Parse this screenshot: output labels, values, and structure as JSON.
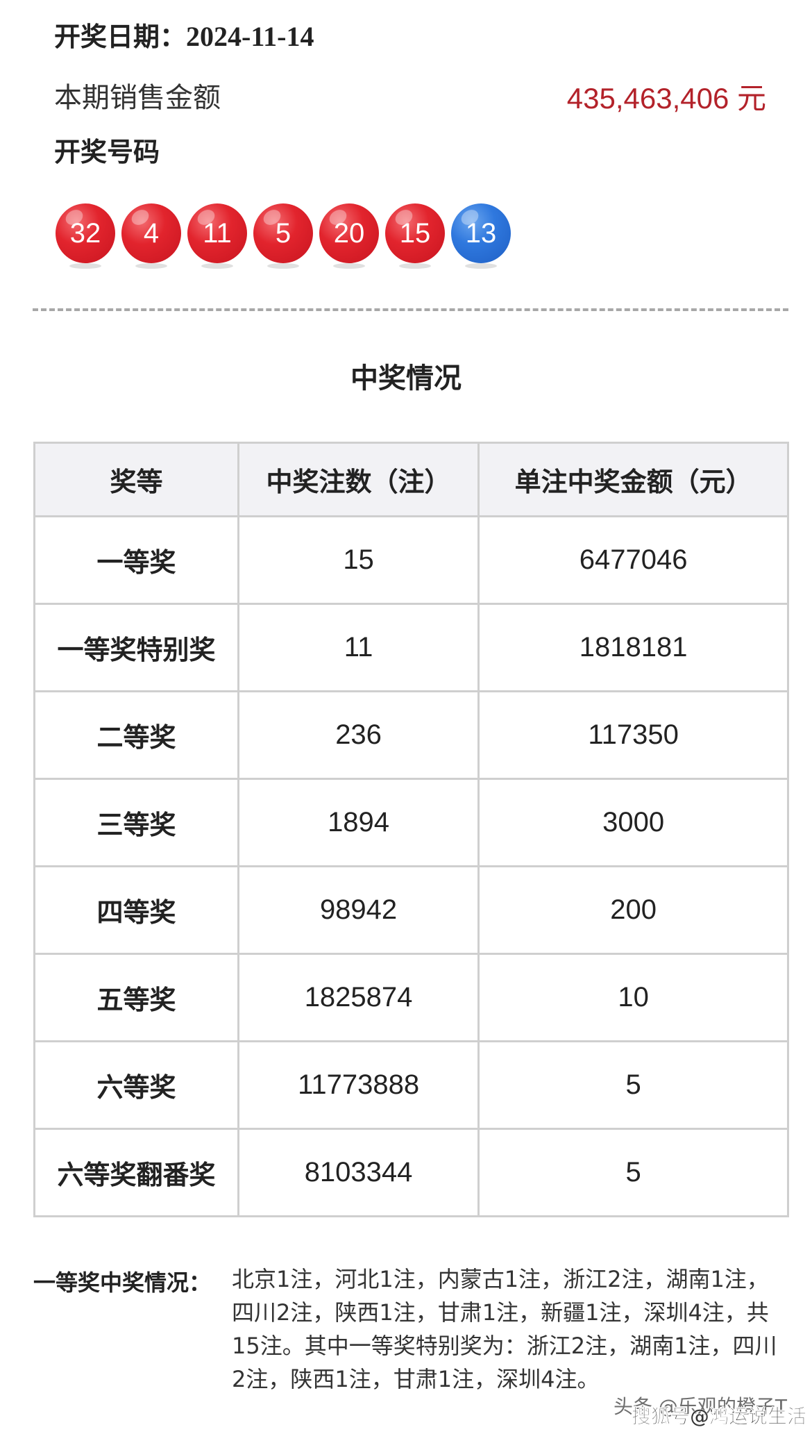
{
  "draw": {
    "date_label": "开奖日期：",
    "date_value": "2024-11-14",
    "sales_label": "本期销售金额",
    "sales_value": "435,463,406 元",
    "numbers_label": "开奖号码",
    "front_numbers": [
      "32",
      "4",
      "11",
      "5",
      "20",
      "15"
    ],
    "back_numbers": [
      "13"
    ],
    "colors": {
      "front_ball": "#e2242d",
      "back_ball": "#2f78de",
      "sales_value": "#b3222a"
    }
  },
  "prizes": {
    "title": "中奖情况",
    "columns": [
      "奖等",
      "中奖注数（注）",
      "单注中奖金额（元）"
    ],
    "rows": [
      {
        "grade": "一等奖",
        "count": "15",
        "amount": "6477046"
      },
      {
        "grade": "一等奖特别奖",
        "count": "11",
        "amount": "1818181"
      },
      {
        "grade": "二等奖",
        "count": "236",
        "amount": "117350"
      },
      {
        "grade": "三等奖",
        "count": "1894",
        "amount": "3000"
      },
      {
        "grade": "四等奖",
        "count": "98942",
        "amount": "200"
      },
      {
        "grade": "五等奖",
        "count": "1825874",
        "amount": "10"
      },
      {
        "grade": "六等奖",
        "count": "11773888",
        "amount": "5"
      },
      {
        "grade": "六等奖翻番奖",
        "count": "8103344",
        "amount": "5"
      }
    ]
  },
  "footnote": {
    "label": "一等奖中奖情况：",
    "text": "北京1注，河北1注，内蒙古1注，浙江2注，湖南1注，四川2注，陕西1注，甘肃1注，新疆1注，深圳4注，共15注。其中一等奖特别奖为：浙江2注，湖南1注，四川2注，陕西1注，甘肃1注，深圳4注。"
  },
  "watermarks": [
    "头条 @乐观的橙子T",
    "搜狐号@鸿运说生活"
  ]
}
